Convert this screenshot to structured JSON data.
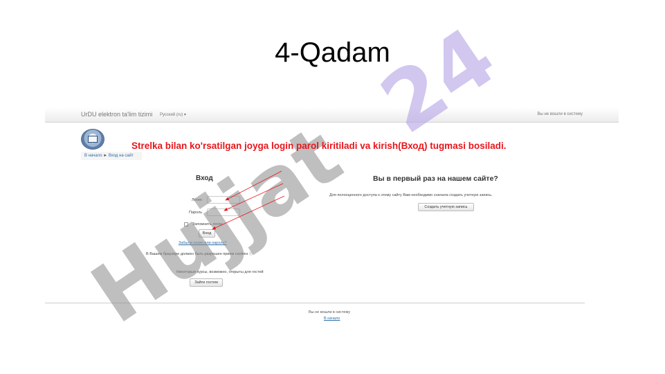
{
  "slide": {
    "title": "4-Qadam"
  },
  "instruction": "Strelka bilan ko'rsatilgan joyga login parol kiritiladi va kirish(Вход) tugmasi bosiladi.",
  "navbar": {
    "brand": "UrDU elektron ta'lim tizimi",
    "language": "Русский (ru) ▾",
    "login_info": "Вы не вошли в систему"
  },
  "breadcrumb": {
    "home": "В начало",
    "separator": "►",
    "current": "Вход на сайт"
  },
  "login": {
    "heading": "Вход",
    "username_label": "Логин",
    "password_label": "Пароль",
    "remember_label": "Запомнить логин",
    "submit": "Вход",
    "forgot": "Забыли логин или пароль?",
    "cookies_note": "В Вашем браузере должен быть разрешен прием cookies ⓘ",
    "guest_note": "Некоторые курсы, возможно, открыты для гостей",
    "guest_button": "Зайти гостем"
  },
  "signup": {
    "heading": "Вы в первый раз на нашем сайте?",
    "text": "Для полноценного доступа к этому сайту Вам необходимо сначала создать учетную запись.",
    "button": "Создать учетную запись"
  },
  "footer": {
    "login_info": "Вы не вошли в систему",
    "home": "В начало"
  },
  "watermark": {
    "text_gray": "Hujjat",
    "text_purple": "24"
  },
  "colors": {
    "instruction": "#e8151b",
    "arrow": "#e8151b",
    "link": "#2a6ca8",
    "watermark_gray": "#8c8c8c",
    "watermark_purple": "#b7a6e6"
  }
}
